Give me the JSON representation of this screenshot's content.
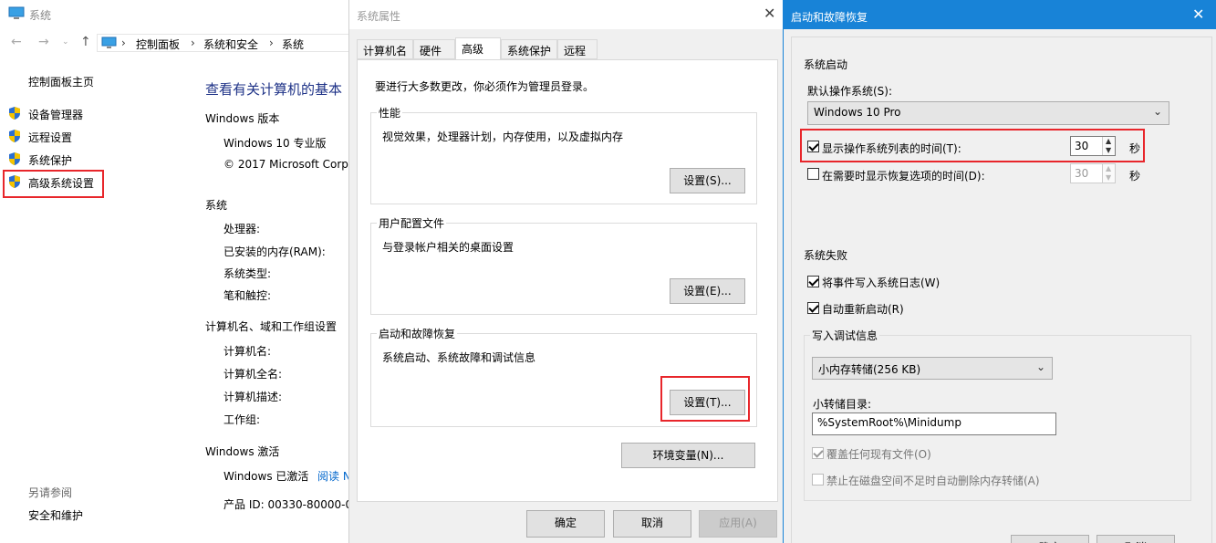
{
  "system_window": {
    "title": "系统",
    "address": [
      "控制面板",
      "系统和安全",
      "系统"
    ],
    "sidebar": {
      "home": "控制面板主页",
      "items": [
        "设备管理器",
        "远程设置",
        "系统保护",
        "高级系统设置"
      ],
      "see_also": "另请参阅",
      "see_also_items": [
        "安全和维护"
      ]
    },
    "main": {
      "heading": "查看有关计算机的基本",
      "windows_edition": "Windows 版本",
      "edition": "Windows 10 专业版",
      "copyright": "© 2017 Microsoft Corp",
      "system": "系统",
      "system_rows": [
        "处理器:",
        "已安装的内存(RAM):",
        "系统类型:",
        "笔和触控:"
      ],
      "computer_name_section": "计算机名、域和工作组设置",
      "computer_rows": [
        "计算机名:",
        "计算机全名:",
        "计算机描述:",
        "工作组:"
      ],
      "activation": "Windows 激活",
      "activated": "Windows 已激活",
      "read_link": "阅读 N",
      "product_id": "产品 ID: 00330-80000-0"
    }
  },
  "sysprops": {
    "title": "系统属性",
    "tabs": [
      "计算机名",
      "硬件",
      "高级",
      "系统保护",
      "远程"
    ],
    "active_tab": "高级",
    "admin_note": "要进行大多数更改，你必须作为管理员登录。",
    "performance": {
      "title": "性能",
      "desc": "视觉效果，处理器计划，内存使用，以及虚拟内存",
      "button": "设置(S)..."
    },
    "user_profiles": {
      "title": "用户配置文件",
      "desc": "与登录帐户相关的桌面设置",
      "button": "设置(E)..."
    },
    "startup_recovery": {
      "title": "启动和故障恢复",
      "desc": "系统启动、系统故障和调试信息",
      "button": "设置(T)..."
    },
    "env_button": "环境变量(N)...",
    "ok": "确定",
    "cancel": "取消",
    "apply": "应用(A)"
  },
  "startup_dialog": {
    "title": "启动和故障恢复",
    "system_startup": "系统启动",
    "default_os_label": "默认操作系统(S):",
    "default_os": "Windows 10 Pro",
    "show_os_list": {
      "label": "显示操作系统列表的时间(T):",
      "checked": true,
      "value": "30",
      "unit": "秒"
    },
    "show_recovery": {
      "label": "在需要时显示恢复选项的时间(D):",
      "checked": false,
      "value": "30",
      "unit": "秒"
    },
    "system_failure": "系统失败",
    "write_event": {
      "label": "将事件写入系统日志(W)",
      "checked": true
    },
    "auto_restart": {
      "label": "自动重新启动(R)",
      "checked": true
    },
    "debug_info": "写入调试信息",
    "dump_type": "小内存转储(256 KB)",
    "dump_dir_label": "小转储目录:",
    "dump_dir": "%SystemRoot%\\Minidump",
    "overwrite": {
      "label": "覆盖任何现有文件(O)",
      "checked": true
    },
    "disable_auto_delete": {
      "label": "禁止在磁盘空间不足时自动删除内存转储(A)",
      "checked": false
    },
    "ok": "确定",
    "cancel": "取消"
  }
}
